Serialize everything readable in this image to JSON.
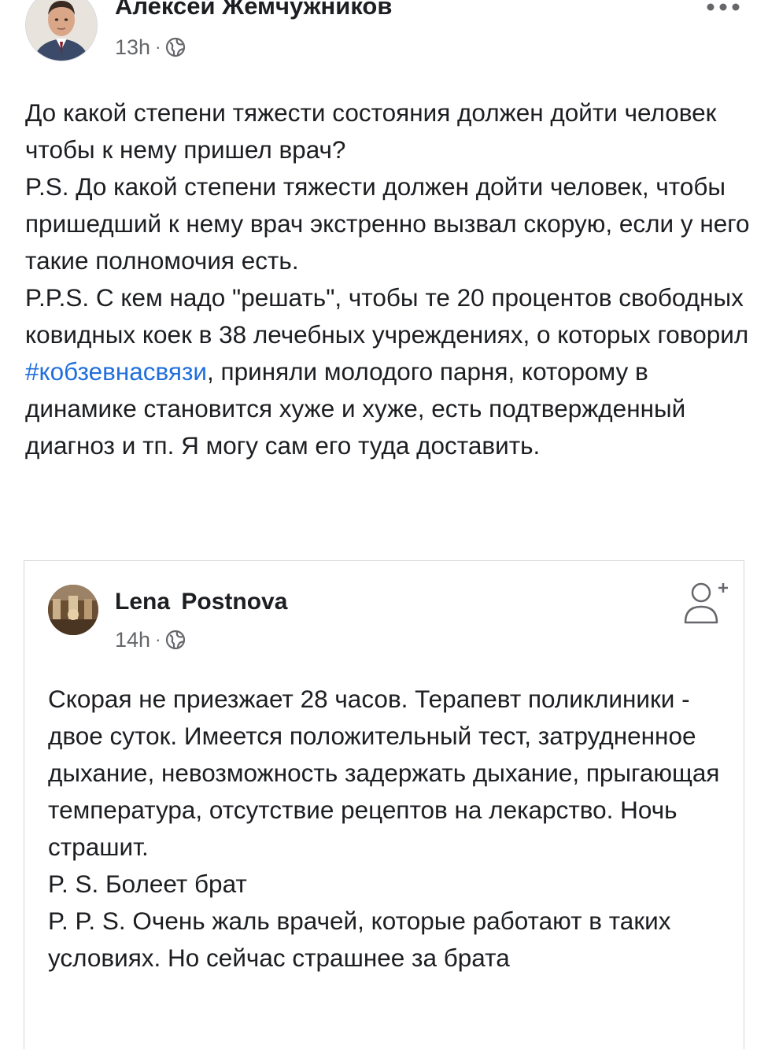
{
  "post": {
    "author": "Алексей Жемчужников",
    "time": "13h",
    "meta_separator": "·",
    "visibility_icon": "globe-icon",
    "more_icon": "more-dots-icon",
    "text": {
      "line1": "До какой степени тяжести состояния должен дойти человек чтобы к нему пришел врач?",
      "line2": "P.S. До какой степени тяжести должен дойти человек, чтобы пришедший к нему врач экстренно вызвал скорую, если у него такие полномочия есть.",
      "line3_before": "P.P.S. С кем надо \"решать\", чтобы те 20 процентов свободных ковидных коек в 38 лечебных учреждениях, о которых говорил ",
      "hashtag": "#кобзевнасвязи",
      "line3_after": ", приняли молодого парня, которому в динамике становится хуже и хуже, есть подтвержденный диагноз и тп. Я могу сам его туда доставить."
    }
  },
  "shared_post": {
    "author": "Lena Postnova",
    "time": "14h",
    "meta_separator": "·",
    "visibility_icon": "globe-icon",
    "add_friend_icon": "add-friend-icon",
    "text": {
      "line1": "Скорая не приезжает 28 часов. Терапевт поликлиники - двое суток. Имеется положительный тест, затрудненное дыхание, невозможность задержать дыхание, прыгающая температура, отсутствие рецептов на лекарство. Ночь страшит.",
      "line2": "P. S. Болеет брат",
      "line3": "P. P. S. Очень жаль врачей, которые работают в таких условиях. Но сейчас страшнее за брата"
    }
  },
  "colors": {
    "text": "#1c1e21",
    "secondary": "#65676b",
    "link": "#216fdb",
    "border": "#d4d6da"
  }
}
